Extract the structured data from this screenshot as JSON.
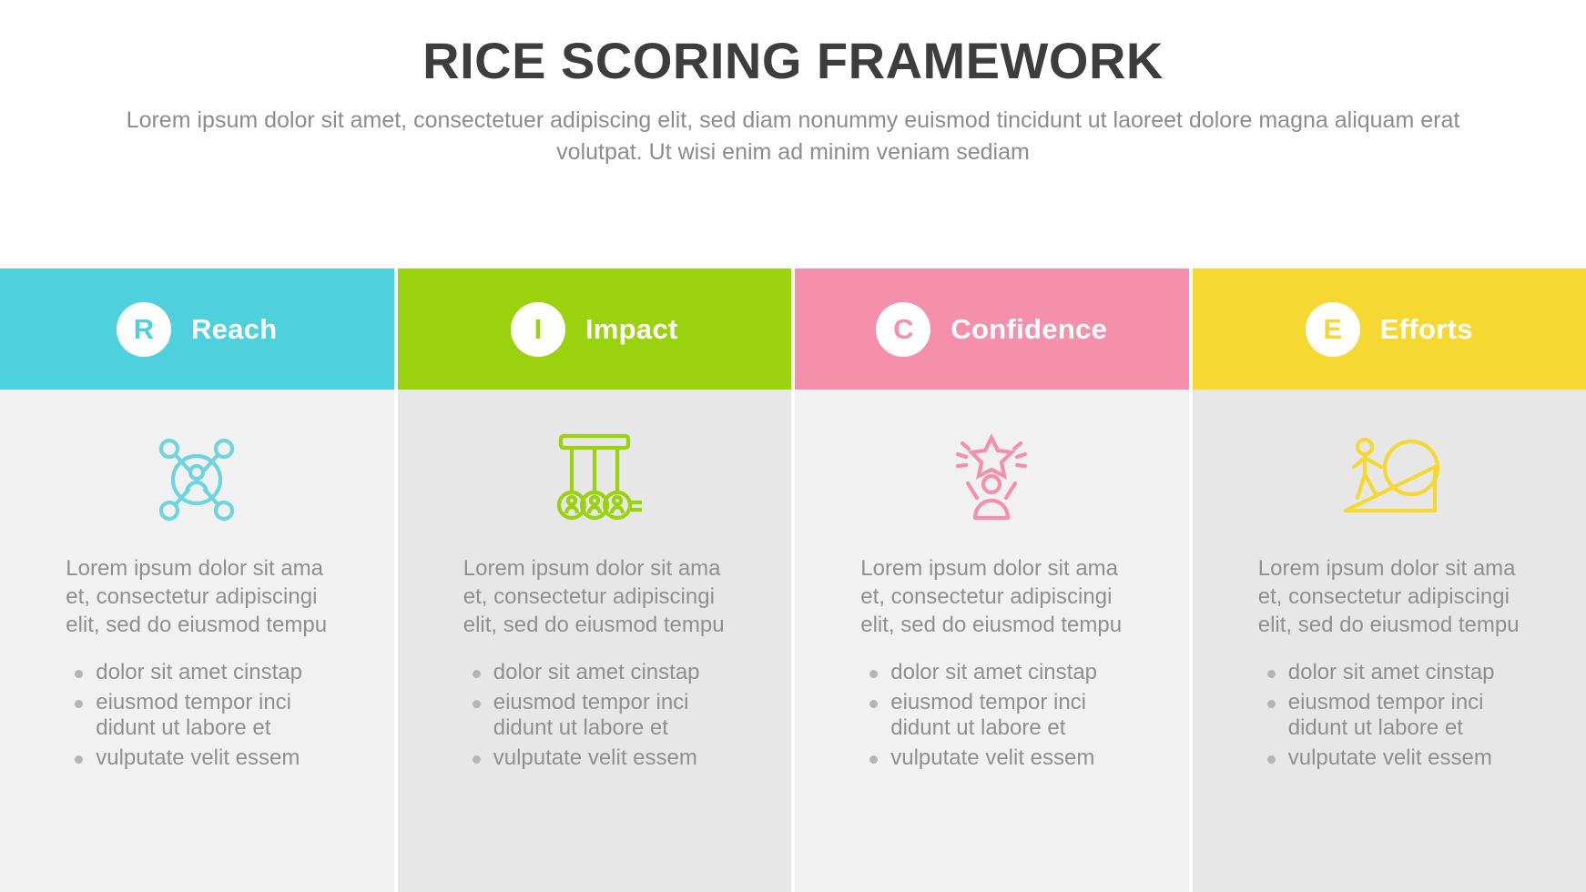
{
  "header": {
    "title": "RICE SCORING FRAMEWORK",
    "subtitle": "Lorem ipsum dolor sit amet, consectetuer adipiscing elit, sed diam nonummy euismod tincidunt ut laoreet dolore magna aliquam erat volutpat. Ut wisi enim ad minim veniam sediam"
  },
  "columns": [
    {
      "letter": "R",
      "label": "Reach",
      "color": "#4fd1dd",
      "body_bg": "#f1f1f1",
      "icon": "network-reach-icon",
      "description": "Lorem ipsum dolor sit ama et, consectetur adipiscingi elit, sed do eiusmod tempu",
      "bullets": [
        "dolor sit amet cinstap",
        "eiusmod tempor inci didunt ut labore et",
        "vulputate velit essem"
      ]
    },
    {
      "letter": "I",
      "label": "Impact",
      "color": "#9ad210",
      "body_bg": "#e7e7e7",
      "icon": "newtons-cradle-icon",
      "description": "Lorem ipsum dolor sit ama et, consectetur adipiscingi elit, sed do eiusmod tempu",
      "bullets": [
        "dolor sit amet cinstap",
        "eiusmod tempor inci didunt ut labore et",
        "vulputate velit essem"
      ]
    },
    {
      "letter": "C",
      "label": "Confidence",
      "color": "#f490ac",
      "body_bg": "#f1f1f1",
      "icon": "person-star-icon",
      "description": "Lorem ipsum dolor sit ama et, consectetur adipiscingi elit, sed do eiusmod tempu",
      "bullets": [
        "dolor sit amet cinstap",
        "eiusmod tempor inci didunt ut labore et",
        "vulputate velit essem"
      ]
    },
    {
      "letter": "E",
      "label": "Efforts",
      "color": "#f5d832",
      "body_bg": "#e7e7e7",
      "icon": "pushing-boulder-icon",
      "description": "Lorem ipsum dolor sit ama et, consectetur adipiscingi elit, sed do eiusmod tempu",
      "bullets": [
        "dolor sit amet cinstap",
        "eiusmod tempor inci didunt ut labore et",
        "vulputate velit essem"
      ]
    }
  ]
}
